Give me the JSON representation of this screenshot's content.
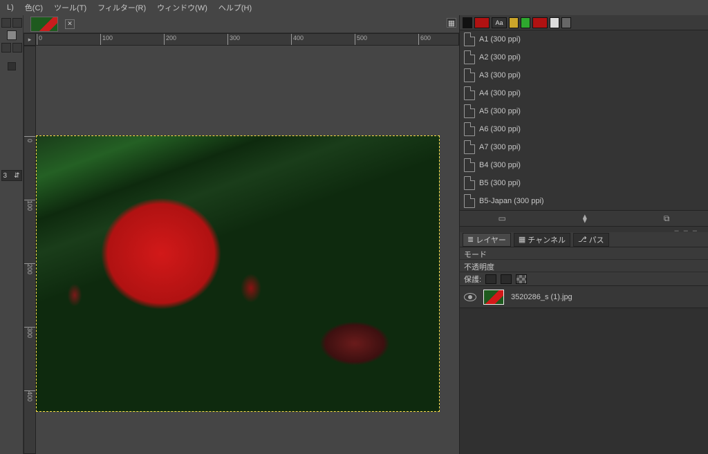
{
  "menu": {
    "layers": "L)",
    "colors": "色(C)",
    "tools": "ツール(T)",
    "filters": "フィルター(R)",
    "windows": "ウィンドウ(W)",
    "help": "ヘルプ(H)"
  },
  "toolbox": {
    "spinner_value": "3"
  },
  "ruler": {
    "h_marks": [
      "0",
      "100",
      "200",
      "300",
      "400",
      "500",
      "600"
    ],
    "v_marks": [
      "0",
      "100",
      "200",
      "300",
      "400"
    ]
  },
  "templates": [
    "A1 (300 ppi)",
    "A2 (300 ppi)",
    "A3 (300 ppi)",
    "A4 (300 ppi)",
    "A5 (300 ppi)",
    "A6 (300 ppi)",
    "A7 (300 ppi)",
    "B4 (300 ppi)",
    "B5 (300 ppi)",
    "B5-Japan (300 ppi)"
  ],
  "panel_tabs": {
    "layers": "レイヤー",
    "channels": "チャンネル",
    "paths": "パス"
  },
  "layers_panel": {
    "mode": "モード",
    "opacity": "不透明度",
    "lock": "保護:",
    "layer_name": "3520286_s (1).jpg"
  },
  "handle": "– – –"
}
